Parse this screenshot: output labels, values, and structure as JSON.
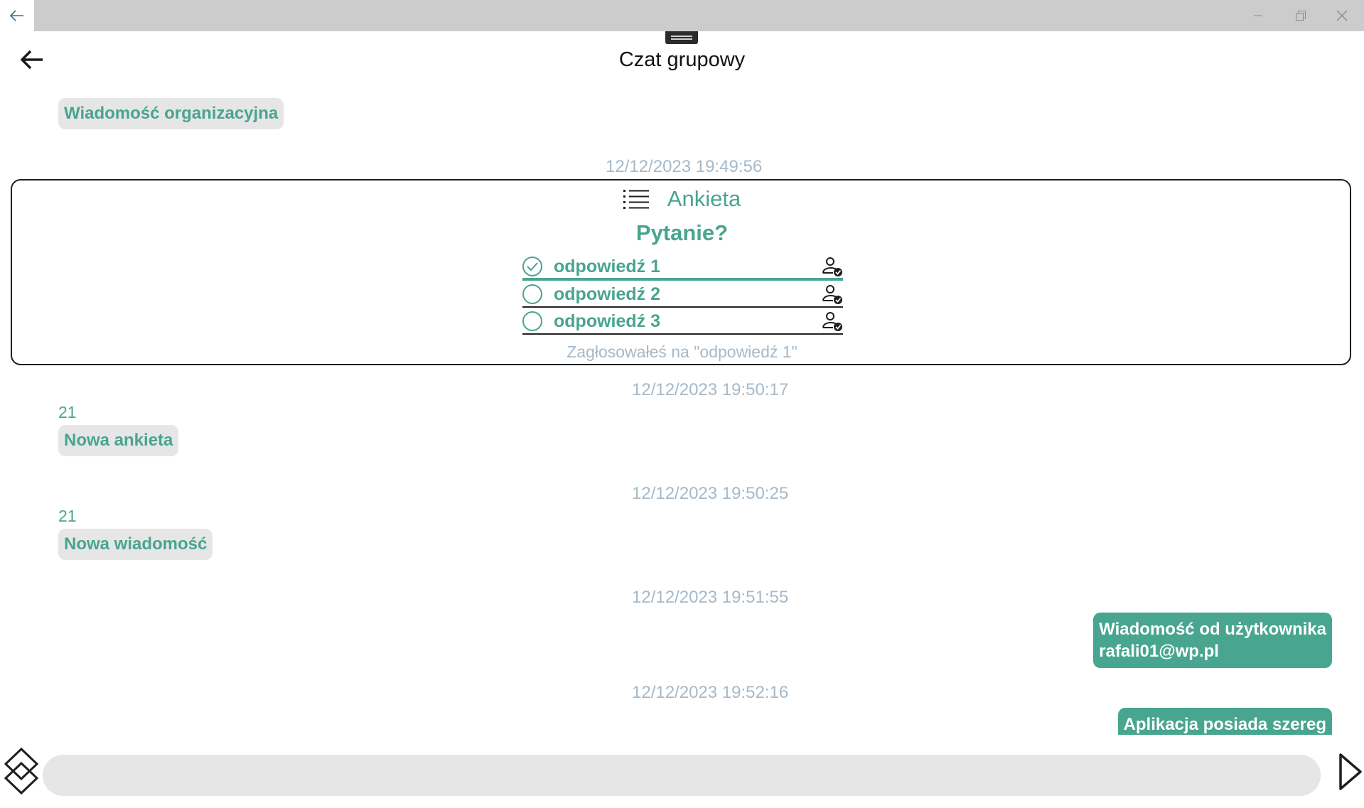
{
  "window": {
    "back_icon": "arrow-left-icon",
    "controls": [
      "minimize-icon",
      "restore-icon",
      "close-icon"
    ]
  },
  "header": {
    "back_icon": "arrow-left-icon",
    "title": "Czat grupowy"
  },
  "messages": {
    "org": {
      "text": "Wiadomość organizacyjna"
    },
    "ts1": "12/12/2023 19:49:56",
    "poll": {
      "icon": "list-icon",
      "title": "Ankieta",
      "question": "Pytanie?",
      "options": [
        {
          "label": "odpowiedź 1",
          "selected": true,
          "icon": "voters-icon"
        },
        {
          "label": "odpowiedź 2",
          "selected": false,
          "icon": "voters-icon"
        },
        {
          "label": "odpowiedź 3",
          "selected": false,
          "icon": "voters-icon"
        }
      ],
      "footer": "Zagłosowałeś na \"odpowiedź 1\""
    },
    "ts2": "12/12/2023 19:50:17",
    "m2": {
      "sender": "21",
      "text": "Nowa ankieta"
    },
    "ts3": "12/12/2023 19:50:25",
    "m3": {
      "sender": "21",
      "text": "Nowa wiadomość"
    },
    "ts4": "12/12/2023 19:51:55",
    "m4": {
      "line1": "Wiadomość od użytkownika",
      "line2": "rafali01@wp.pl"
    },
    "ts5": "12/12/2023 19:52:16",
    "m5": {
      "text": "Aplikacja posiada szereg"
    }
  },
  "composer": {
    "attach_icon": "diamond-menu-icon",
    "input_value": "",
    "input_placeholder": "",
    "send_icon": "send-icon"
  },
  "colors": {
    "accent": "#48a58f",
    "timestamp": "#a6b9c8",
    "bubble_gray": "#e6e6e6",
    "titlebar": "#cccccc"
  }
}
